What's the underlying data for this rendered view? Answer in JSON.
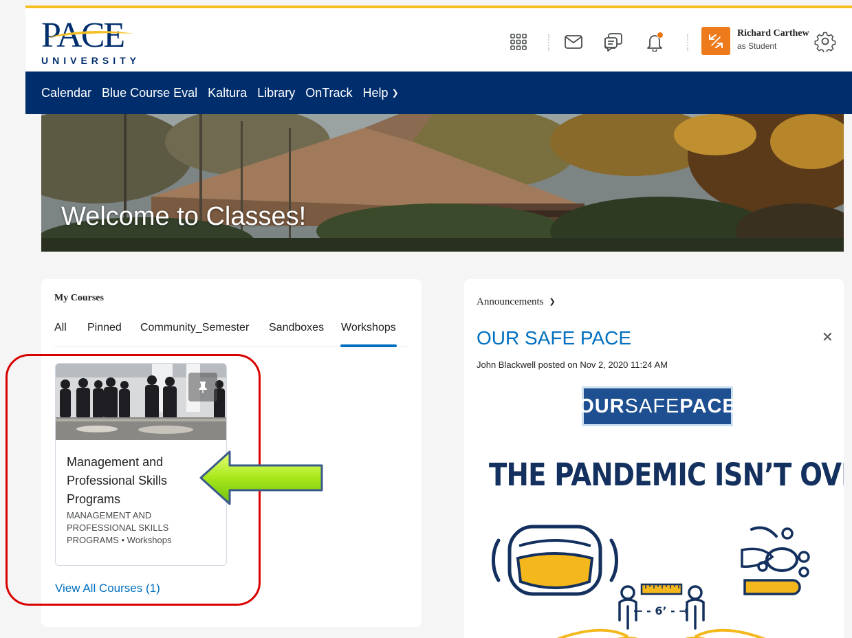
{
  "header": {
    "logo": {
      "name": "PACE",
      "subtitle": "UNIVERSITY"
    },
    "icons": [
      "apps-grid-icon",
      "mail-icon",
      "chat-icon",
      "bell-icon"
    ],
    "user": {
      "name": "Richard Carthew",
      "role": "as Student"
    },
    "colors": {
      "accent": "#f4c021",
      "navy": "#002e6d",
      "avatar": "#ed7b1c"
    }
  },
  "nav": {
    "items": [
      "Calendar",
      "Blue Course Eval",
      "Kaltura",
      "Library",
      "OnTrack",
      "Help"
    ]
  },
  "banner": {
    "title": "Welcome to Classes!"
  },
  "my_courses": {
    "title": "My Courses",
    "tabs": [
      "All",
      "Pinned",
      "Community_Semester",
      "Sandboxes",
      "Workshops"
    ],
    "active_tab": "Workshops",
    "course": {
      "name": "Management and Professional Skills Programs",
      "code": "MANAGEMENT AND PROFESSIONAL SKILLS PROGRAMS",
      "separator": "•",
      "type": "Workshops"
    },
    "view_all": "View All Courses (1)"
  },
  "announcements": {
    "header": "Announcements",
    "title": "OUR SAFE PACE",
    "meta": "John Blackwell posted on Nov 2, 2020 11:24 AM",
    "badge": {
      "our": "OUR",
      "safe": "SAFE",
      "pace": "PACE"
    },
    "headline": "THE PANDEMIC ISN’T OVER.",
    "distance_label": "← - 6’ - →"
  }
}
